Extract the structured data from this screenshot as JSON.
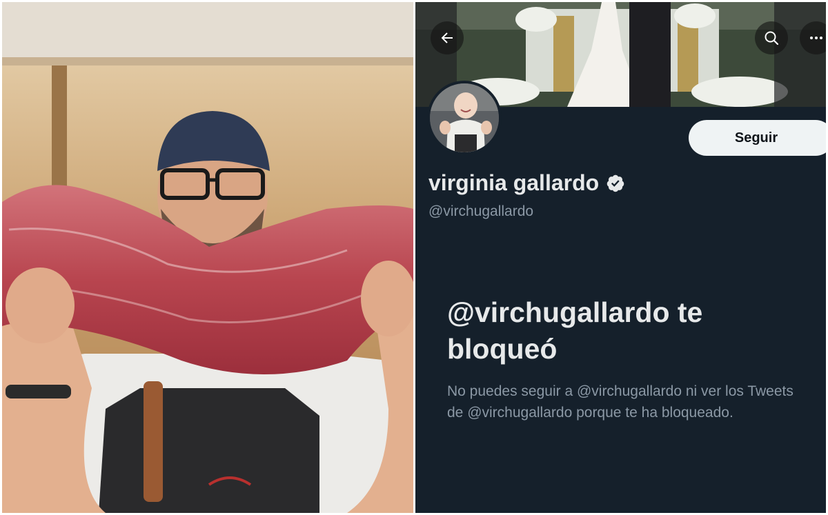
{
  "profile": {
    "follow_label": "Seguir",
    "display_name": "virginia gallardo",
    "handle": "@virchugallardo"
  },
  "blocked": {
    "title": "@virchugallardo te bloqueó",
    "description": "No puedes seguir a @virchugallardo ni ver los Tweets de @virchugallardo porque te ha bloqueado."
  },
  "icons": {
    "back": "arrow-left-icon",
    "search": "search-icon",
    "more": "more-horizontal-icon",
    "verified": "verified-badge-icon"
  },
  "colors": {
    "background": "#15202b",
    "primary_text": "#e7e9ea",
    "secondary_text": "#8b98a5",
    "follow_button_bg": "#eff3f4",
    "follow_button_text": "#0f1419"
  }
}
